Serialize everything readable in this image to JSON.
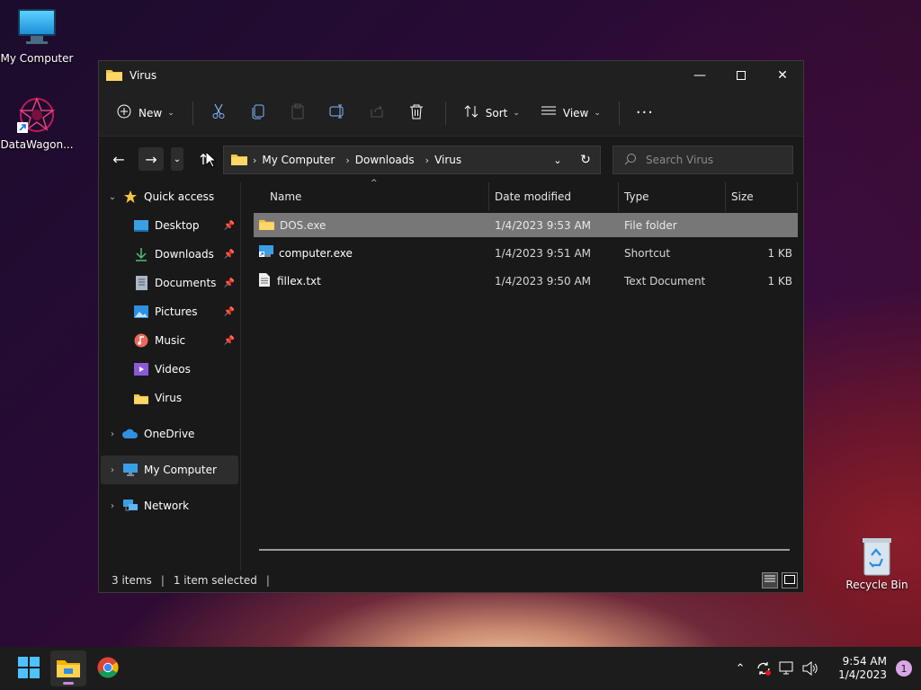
{
  "desktop": {
    "icons": [
      {
        "label": "My Computer",
        "icon": "monitor-icon"
      },
      {
        "label": "DataWagon...",
        "icon": "datawagon-shortcut-icon"
      },
      {
        "label": "Recycle Bin",
        "icon": "recycle-bin-icon"
      }
    ]
  },
  "window": {
    "title": "Virus",
    "toolbar": {
      "new_label": "New",
      "sort_label": "Sort",
      "view_label": "View"
    },
    "address": {
      "crumbs": [
        "My Computer",
        "Downloads",
        "Virus"
      ]
    },
    "search": {
      "placeholder": "Search Virus"
    },
    "sidebar": {
      "items": [
        {
          "label": "Quick access",
          "icon": "star-icon",
          "expandable": true
        },
        {
          "label": "Desktop",
          "icon": "desktop-icon",
          "pinned": true
        },
        {
          "label": "Downloads",
          "icon": "download-icon",
          "pinned": true
        },
        {
          "label": "Documents",
          "icon": "document-icon",
          "pinned": true
        },
        {
          "label": "Pictures",
          "icon": "pictures-icon",
          "pinned": true
        },
        {
          "label": "Music",
          "icon": "music-icon",
          "pinned": true
        },
        {
          "label": "Videos",
          "icon": "videos-icon"
        },
        {
          "label": "Virus",
          "icon": "folder-icon"
        },
        {
          "label": "OneDrive",
          "icon": "cloud-icon",
          "expandable": true
        },
        {
          "label": "My Computer",
          "icon": "monitor-icon",
          "expandable": true,
          "selected": true
        },
        {
          "label": "Network",
          "icon": "network-icon",
          "expandable": true
        }
      ]
    },
    "columns": [
      "Name",
      "Date modified",
      "Type",
      "Size"
    ],
    "files": [
      {
        "name": "DOS.exe",
        "date": "1/4/2023 9:53 AM",
        "type": "File folder",
        "size": "",
        "icon": "folder-icon",
        "selected": true
      },
      {
        "name": "computer.exe",
        "date": "1/4/2023 9:51 AM",
        "type": "Shortcut",
        "size": "1 KB",
        "icon": "shortcut-icon"
      },
      {
        "name": "fillex.txt",
        "date": "1/4/2023 9:50 AM",
        "type": "Text Document",
        "size": "1 KB",
        "icon": "text-file-icon"
      }
    ],
    "status": {
      "items_count": "3 items",
      "selected": "1 item selected"
    }
  },
  "taskbar": {
    "apps": [
      {
        "name": "start",
        "icon": "windows-start-icon"
      },
      {
        "name": "file-explorer",
        "icon": "file-explorer-icon",
        "active": true
      },
      {
        "name": "chrome",
        "icon": "chrome-icon"
      }
    ],
    "clock": {
      "time": "9:54 AM",
      "date": "1/4/2023"
    },
    "notifications": "1"
  },
  "colors": {
    "accent_folder": "#f4c542",
    "window_bg": "#191919",
    "selected_row": "#777777",
    "taskbar_bg": "#1c1c1c"
  }
}
